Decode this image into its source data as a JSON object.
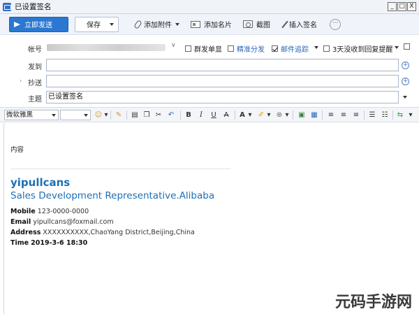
{
  "window": {
    "title": "已设置签名",
    "controls": [
      "_",
      "□",
      "X"
    ]
  },
  "toolbar": {
    "send_label": "立即发送",
    "save_label": "保存",
    "attach_label": "添加附件",
    "card_label": "添加名片",
    "screenshot_label": "截图",
    "signature_label": "插入签名",
    "more_label": "···"
  },
  "header": {
    "account_label": "帐号",
    "options": {
      "group_single": "群发单显",
      "precise": "精准分发",
      "tracking": "邮件追踪",
      "reminder": "3天没收到回复提醒"
    },
    "to_label": "发到",
    "cc_label": "抄送",
    "subject_label": "主题",
    "subject_value": "已设置签名",
    "to_value": "",
    "cc_value": ""
  },
  "format": {
    "font": "微软雅黑",
    "bold": "B",
    "italic": "I",
    "underline": "U",
    "strike": "A",
    "fontcolor": "A"
  },
  "body": {
    "content": "内容",
    "signature": {
      "name": "yipullcans",
      "title": "Sales Development Representative.Alibaba",
      "mobile_label": "Mobile",
      "mobile": "123-0000-0000",
      "email_label": "Email",
      "email": "yipullcans@foxmail.com",
      "address_label": "Address",
      "address": "XXXXXXXXXX,ChaoYang District,Beijing,China",
      "time_label": "Time",
      "time": "2019-3-6 18:30"
    }
  },
  "watermark": "元码手游网",
  "colors": {
    "accent": "#2a78d2",
    "signature": "#1d6fb7"
  }
}
